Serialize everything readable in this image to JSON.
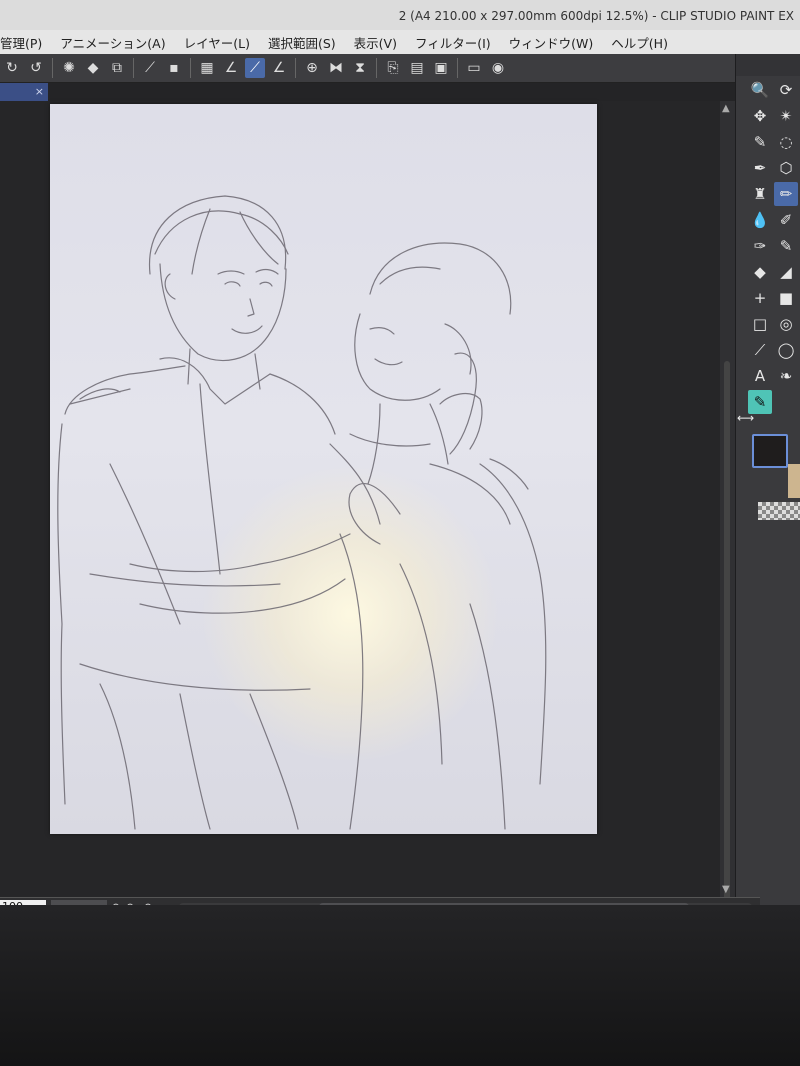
{
  "window": {
    "title": "2 (A4 210.00 x 297.00mm 600dpi 12.5%) - CLIP STUDIO PAINT EX"
  },
  "menu": [
    "管理(P)",
    "アニメーション(A)",
    "レイヤー(L)",
    "選択範囲(S)",
    "表示(V)",
    "フィルター(I)",
    "ウィンドウ(W)",
    "ヘルプ(H)"
  ],
  "toolbar_icons": [
    "rotate-icon",
    "redo-icon",
    "spinner-icon",
    "fill-icon",
    "transform-icon",
    "crop-icon",
    "clear-icon",
    "checker-icon",
    "pen-check-icon",
    "pen-active-icon",
    "pen-line-icon",
    "snap-icon",
    "flip-h-icon",
    "flip-v-icon",
    "import-icon",
    "export-icon",
    "export2-icon",
    "screen-icon",
    "camera-icon"
  ],
  "document_tab": {
    "close": "×"
  },
  "tools": [
    {
      "icon": "zoom-icon",
      "glyph": "🔍"
    },
    {
      "icon": "rotate-view-icon",
      "glyph": "⟳"
    },
    {
      "icon": "move-icon",
      "glyph": "✥"
    },
    {
      "icon": "sparkle-icon",
      "glyph": "✴"
    },
    {
      "icon": "eyedropper-icon",
      "glyph": "✎"
    },
    {
      "icon": "lasso-icon",
      "glyph": "◌"
    },
    {
      "icon": "pen-icon",
      "glyph": "✒"
    },
    {
      "icon": "object-select-icon",
      "glyph": "⬡"
    },
    {
      "icon": "stamp-icon",
      "glyph": "♜"
    },
    {
      "icon": "pencil-active-icon",
      "glyph": "✏"
    },
    {
      "icon": "drop-icon",
      "glyph": "💧"
    },
    {
      "icon": "marker-icon",
      "glyph": "✐"
    },
    {
      "icon": "brush-icon",
      "glyph": "✑"
    },
    {
      "icon": "airbrush-icon",
      "glyph": "✎"
    },
    {
      "icon": "fill-bucket-icon",
      "glyph": "◆"
    },
    {
      "icon": "eraser-icon",
      "glyph": "◢"
    },
    {
      "icon": "blend-icon",
      "glyph": "+"
    },
    {
      "icon": "gradient-icon",
      "glyph": "■"
    },
    {
      "icon": "rectangle-icon",
      "glyph": "□"
    },
    {
      "icon": "spiral-icon",
      "glyph": "◎"
    },
    {
      "icon": "ruler-icon",
      "glyph": "⟋"
    },
    {
      "icon": "balloon-icon",
      "glyph": "◯"
    },
    {
      "icon": "text-icon",
      "glyph": "A"
    },
    {
      "icon": "leaf-icon",
      "glyph": "❧"
    },
    {
      "icon": "resize-icon",
      "glyph": "⟷"
    },
    {
      "icon": "correction-pen-icon",
      "glyph": "✎"
    }
  ],
  "colors": {
    "foreground": "#1f1d1d",
    "background": "#cdb58f",
    "accent": "#4a6aa8",
    "teal": "#4fc4b6"
  },
  "status": {
    "zoom": "100",
    "rotate_left": "↶",
    "rotate_right": "↷",
    "reset": "⟲",
    "collapse": "‹"
  }
}
